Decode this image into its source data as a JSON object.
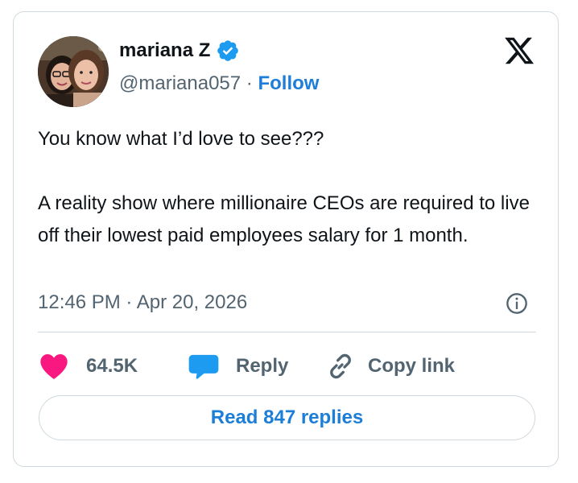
{
  "author": {
    "display_name": "mariana Z",
    "handle": "@mariana057",
    "separator": "·",
    "follow_label": "Follow",
    "verified_icon": "verified-badge-icon"
  },
  "tweet": {
    "lines": [
      "You know what I’d love to see???",
      "A reality show where millionaire CEOs are required to live off their lowest paid employees salary for 1 month."
    ],
    "time": "12:46 PM",
    "separator": "·",
    "date": "Apr 20, 2026"
  },
  "actions": {
    "like_count": "64.5K",
    "reply_label": "Reply",
    "copy_label": "Copy link",
    "read_replies_label": "Read 847 replies"
  },
  "icons": {
    "brand": "x-logo-icon",
    "info": "info-icon",
    "like": "heart-icon",
    "reply": "speech-bubble-icon",
    "copy": "link-icon"
  },
  "colors": {
    "accent_blue": "#1d7ed8",
    "verified_blue": "#1d9bf0",
    "like_pink": "#f91880",
    "secondary_text": "#536471",
    "border": "#cfd9de"
  }
}
